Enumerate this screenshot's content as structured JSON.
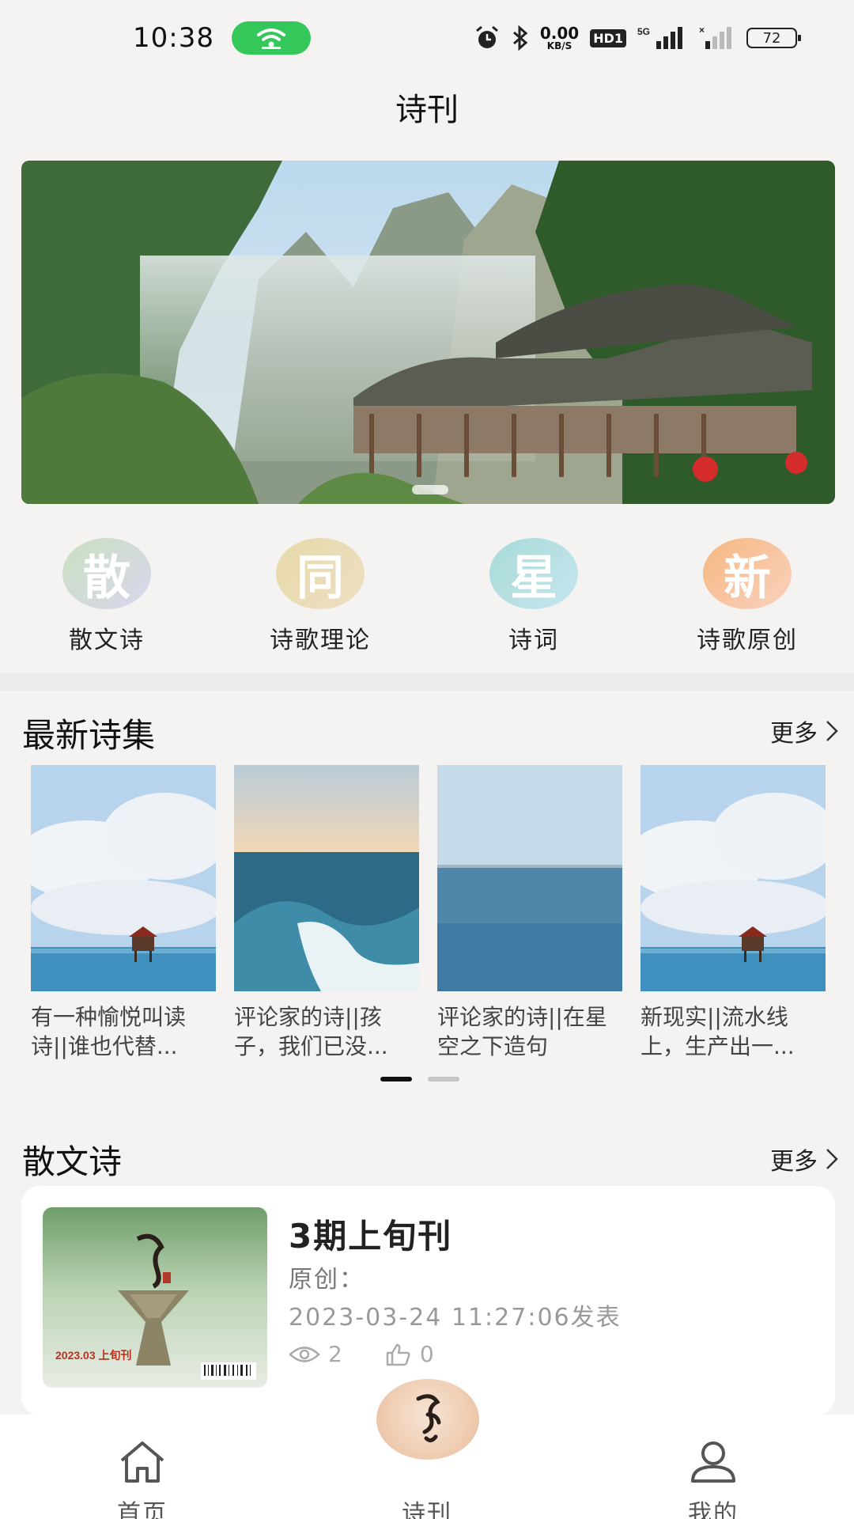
{
  "status_bar": {
    "time": "10:38",
    "net_speed_value": "0.00",
    "net_speed_unit": "KB/S",
    "hd_label": "HD1",
    "signal_label": "5G",
    "battery_level": "72"
  },
  "header": {
    "title": "诗刊"
  },
  "categories": [
    {
      "char": "散",
      "label": "散文诗",
      "color_a": "#c9e0c0",
      "color_b": "#d9d6ee"
    },
    {
      "char": "同",
      "label": "诗歌理论",
      "color_a": "#e6d9a8",
      "color_b": "#eedfc3"
    },
    {
      "char": "星",
      "label": "诗词",
      "color_a": "#a8dad8",
      "color_b": "#c6e6ee"
    },
    {
      "char": "新",
      "label": "诗歌原创",
      "color_a": "#f6b77f",
      "color_b": "#f9d2c0"
    }
  ],
  "latest_collection": {
    "title": "最新诗集",
    "more_label": "更多",
    "items": [
      {
        "text": "有一种愉悦叫读诗||谁也代替..."
      },
      {
        "text": "评论家的诗||孩子，我们已没..."
      },
      {
        "text": "评论家的诗||在星空之下造句"
      },
      {
        "text": "新现实||流水线上，生产出一..."
      }
    ]
  },
  "prose_poetry": {
    "title": "散文诗",
    "more_label": "更多",
    "card": {
      "title": "3期上旬刊",
      "author_label": "原创：",
      "date": "2023-03-24 11:27:06发表",
      "views": "2",
      "likes": "0",
      "cover_text": "2023.03 上旬刊"
    }
  },
  "bottom_nav": {
    "home": "首页",
    "journal": "诗刊",
    "mine": "我的"
  },
  "colors": {
    "accent_green": "#34c759",
    "page_bg": "#f4f3f2"
  }
}
